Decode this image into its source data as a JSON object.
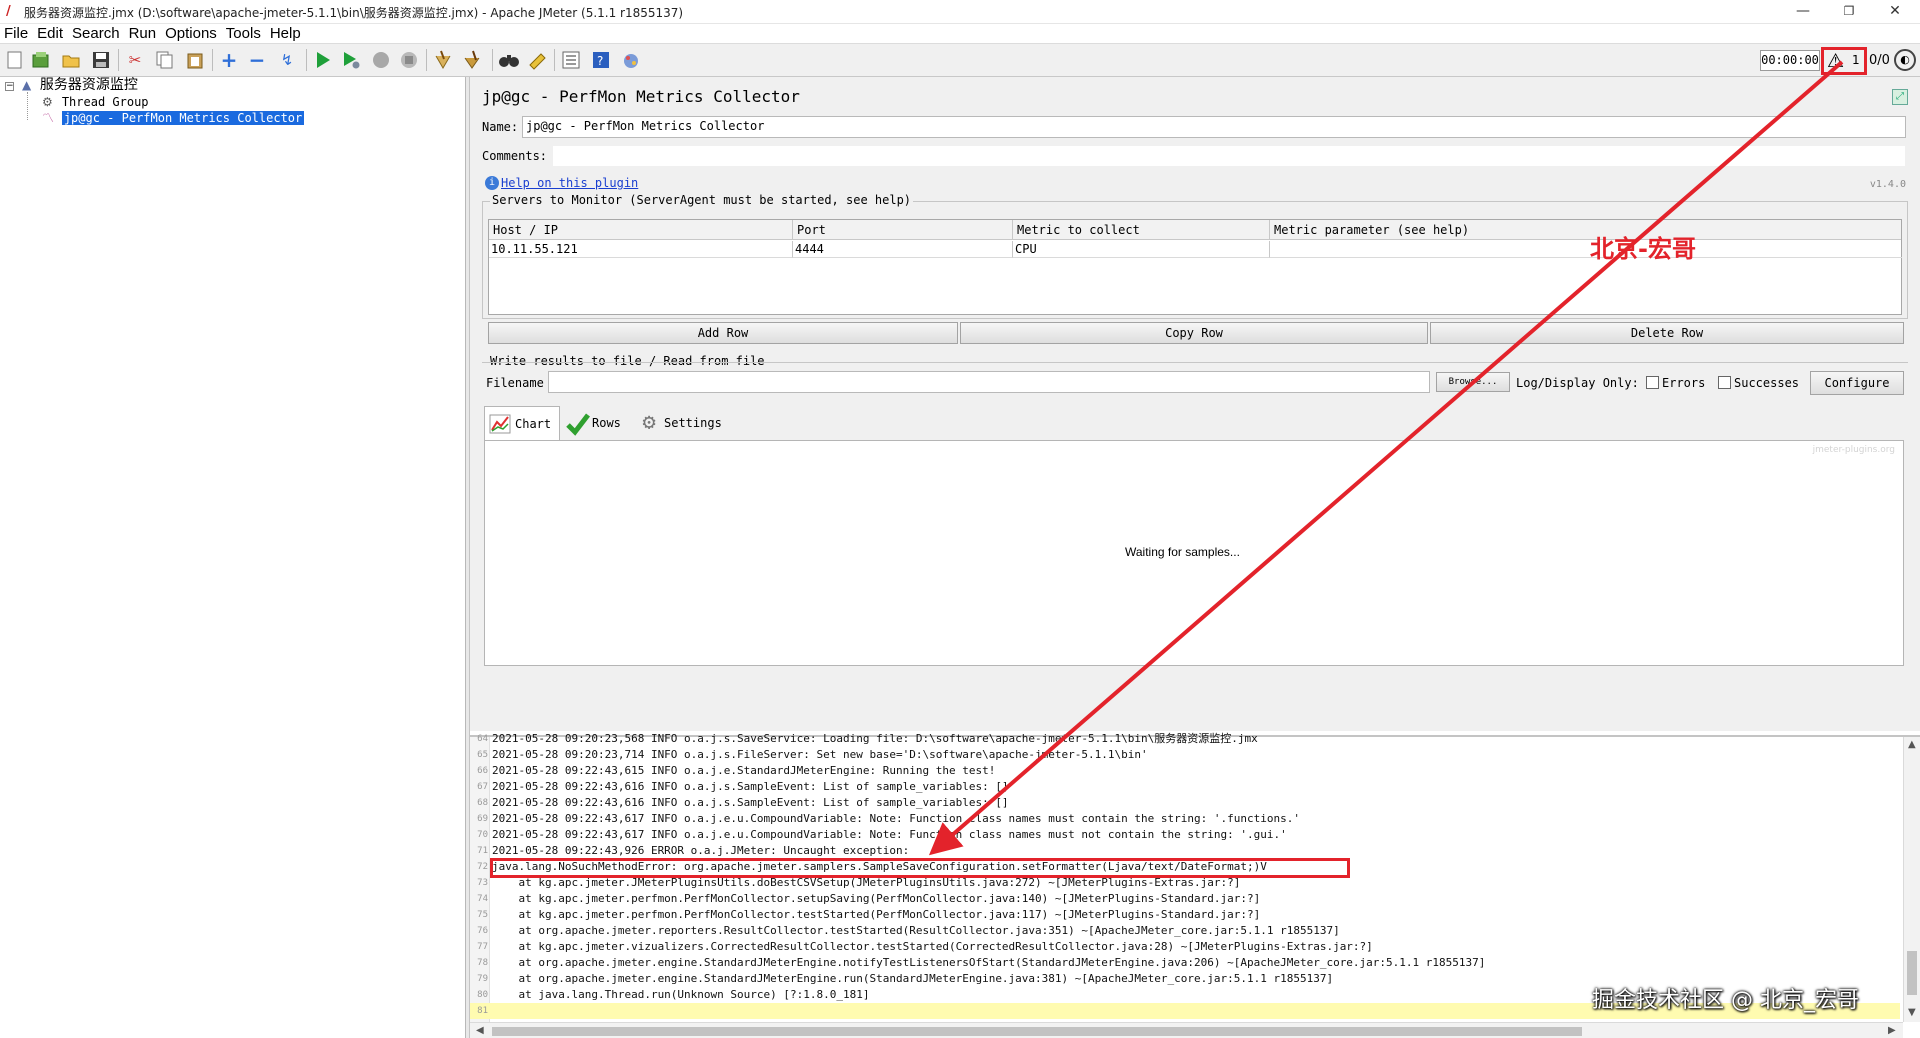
{
  "window": {
    "title": "服务器资源监控.jmx (D:\\software\\apache-jmeter-5.1.1\\bin\\服务器资源监控.jmx) - Apache JMeter (5.1.1 r1855137)",
    "min_glyph": "—",
    "restore_glyph": "❐",
    "close_glyph": "✕"
  },
  "menu": [
    "File",
    "Edit",
    "Search",
    "Run",
    "Options",
    "Tools",
    "Help"
  ],
  "toolbar": {
    "icons": [
      "new-icon",
      "templates-icon",
      "open-icon",
      "save-icon",
      "cut-icon",
      "copy-icon",
      "paste-icon",
      "expand-icon",
      "collapse-icon",
      "toggle-icon",
      "start-icon",
      "start-no-pause-icon",
      "stop-icon",
      "shutdown-icon",
      "clear-icon",
      "clear-all-icon",
      "search-icon",
      "reset-search-icon",
      "function-helper-icon",
      "help-icon",
      "logger-icon"
    ],
    "timer": "00:00:00",
    "warning_count": "1",
    "thread_count": "0/0"
  },
  "tree": {
    "root": "服务器资源监控",
    "thread_group": "Thread Group",
    "selected": "jp@gc - PerfMon Metrics Collector"
  },
  "panel": {
    "title": "jp@gc - PerfMon Metrics Collector",
    "name_label": "Name:",
    "name_value": "jp@gc - PerfMon Metrics Collector",
    "comments_label": "Comments:",
    "comments_value": "",
    "help_link": "Help on this plugin",
    "version": "v1.4.0",
    "servers_title": "Servers to Monitor (ServerAgent must be started, see help)",
    "columns": [
      "Host / IP",
      "Port",
      "Metric to collect",
      "Metric parameter (see help)"
    ],
    "rows": [
      [
        "10.11.55.121",
        "4444",
        "CPU",
        ""
      ]
    ],
    "buttons": {
      "add_row": "Add Row",
      "copy_row": "Copy Row",
      "delete_row": "Delete Row"
    },
    "file_section_title": "Write results to file / Read from file",
    "filename_label": "Filename",
    "filename_value": "",
    "browse": "Browse...",
    "log_display_only": "Log/Display Only:",
    "errors_label": "Errors",
    "successes_label": "Successes",
    "configure": "Configure",
    "tabs": [
      "Chart",
      "Rows",
      "Settings"
    ],
    "chart_watermark": "jmeter-plugins.org",
    "chart_message": "Waiting for samples..."
  },
  "log": {
    "lines": [
      {
        "n": "64",
        "t": "2021-05-28 09:20:23,568 INFO o.a.j.s.SaveService: Loading file: D:\\software\\apache-jmeter-5.1.1\\bin\\服务器资源监控.jmx"
      },
      {
        "n": "65",
        "t": "2021-05-28 09:20:23,714 INFO o.a.j.s.FileServer: Set new base='D:\\software\\apache-jmeter-5.1.1\\bin'"
      },
      {
        "n": "66",
        "t": "2021-05-28 09:22:43,615 INFO o.a.j.e.StandardJMeterEngine: Running the test!"
      },
      {
        "n": "67",
        "t": "2021-05-28 09:22:43,616 INFO o.a.j.s.SampleEvent: List of sample_variables: []"
      },
      {
        "n": "68",
        "t": "2021-05-28 09:22:43,616 INFO o.a.j.s.SampleEvent: List of sample_variables: []"
      },
      {
        "n": "69",
        "t": "2021-05-28 09:22:43,617 INFO o.a.j.e.u.CompoundVariable: Note: Function class names must contain the string: '.functions.'"
      },
      {
        "n": "70",
        "t": "2021-05-28 09:22:43,617 INFO o.a.j.e.u.CompoundVariable: Note: Function class names must not contain the string: '.gui.'"
      },
      {
        "n": "71",
        "t": "2021-05-28 09:22:43,926 ERROR o.a.j.JMeter: Uncaught exception:"
      },
      {
        "n": "72",
        "t": "java.lang.NoSuchMethodError: org.apache.jmeter.samplers.SampleSaveConfiguration.setFormatter(Ljava/text/DateFormat;)V"
      },
      {
        "n": "73",
        "t": "    at kg.apc.jmeter.JMeterPluginsUtils.doBestCSVSetup(JMeterPluginsUtils.java:272) ~[JMeterPlugins-Extras.jar:?]"
      },
      {
        "n": "74",
        "t": "    at kg.apc.jmeter.perfmon.PerfMonCollector.setupSaving(PerfMonCollector.java:140) ~[JMeterPlugins-Standard.jar:?]"
      },
      {
        "n": "75",
        "t": "    at kg.apc.jmeter.perfmon.PerfMonCollector.testStarted(PerfMonCollector.java:117) ~[JMeterPlugins-Standard.jar:?]"
      },
      {
        "n": "76",
        "t": "    at org.apache.jmeter.reporters.ResultCollector.testStarted(ResultCollector.java:351) ~[ApacheJMeter_core.jar:5.1.1 r1855137]"
      },
      {
        "n": "77",
        "t": "    at kg.apc.jmeter.vizualizers.CorrectedResultCollector.testStarted(CorrectedResultCollector.java:28) ~[JMeterPlugins-Extras.jar:?]"
      },
      {
        "n": "78",
        "t": "    at org.apache.jmeter.engine.StandardJMeterEngine.notifyTestListenersOfStart(StandardJMeterEngine.java:206) ~[ApacheJMeter_core.jar:5.1.1 r1855137]"
      },
      {
        "n": "79",
        "t": "    at org.apache.jmeter.engine.StandardJMeterEngine.run(StandardJMeterEngine.java:381) ~[ApacheJMeter_core.jar:5.1.1 r1855137]"
      },
      {
        "n": "80",
        "t": "    at java.lang.Thread.run(Unknown Source) [?:1.8.0_181]"
      },
      {
        "n": "81",
        "t": ""
      }
    ]
  },
  "annotations": {
    "author_label": "北京-宏哥",
    "bottom_watermark": "掘金技术社区 @ 北京_宏哥",
    "highlight_color": "#e3232b"
  }
}
